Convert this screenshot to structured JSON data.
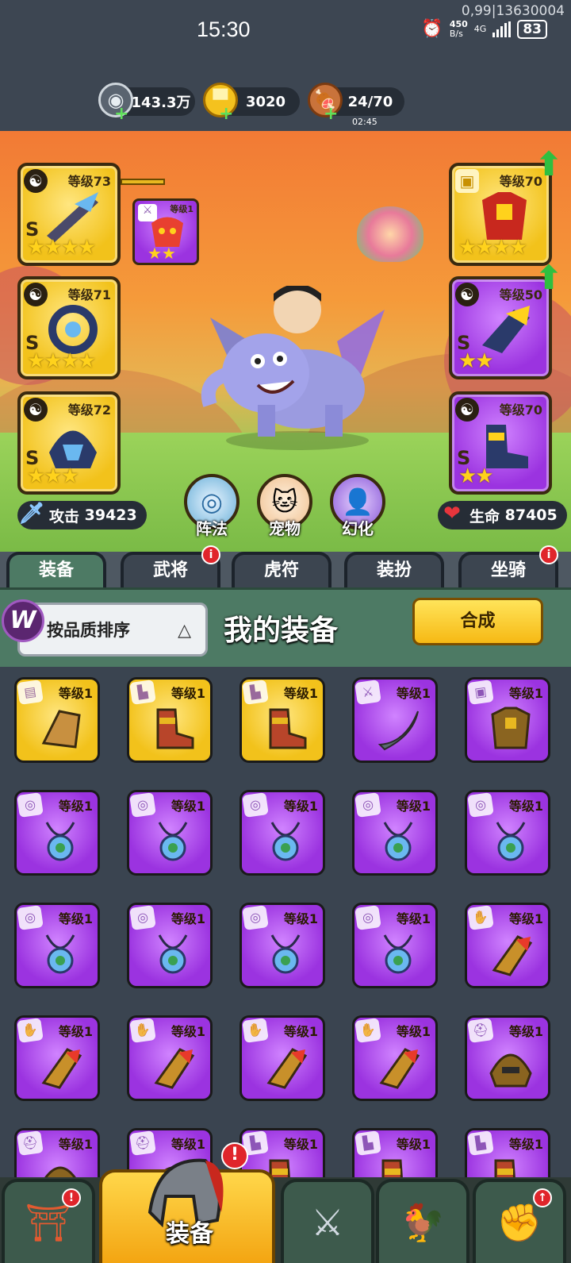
{
  "status_bar": {
    "time": "15:30",
    "overlay_text": "0,99|13630004",
    "net_speed_value": "450",
    "net_speed_unit": "B/s",
    "network": "4G",
    "battery": "83"
  },
  "resources": {
    "silver": "143.3万",
    "gold": "3020",
    "stamina": "24/70",
    "stamina_timer": "02:45"
  },
  "hero": {
    "left_slots": [
      {
        "level": "等级73",
        "grade": "S",
        "stars": "★★★★",
        "color": "gold"
      },
      {
        "level": "等级71",
        "grade": "S",
        "stars": "★★★★",
        "color": "gold"
      },
      {
        "level": "等级72",
        "grade": "S",
        "stars": "★★★",
        "color": "gold"
      }
    ],
    "right_slots": [
      {
        "level": "等级70",
        "grade": "S",
        "stars": "★★★★",
        "color": "gold"
      },
      {
        "level": "等级50",
        "grade": "S",
        "stars": "★★",
        "color": "purple"
      },
      {
        "level": "等级70",
        "grade": "S",
        "stars": "★★",
        "color": "purple"
      }
    ],
    "pet_slot": {
      "level": "等级1",
      "stars": "★★"
    },
    "attack_label": "攻击",
    "attack_value": "39423",
    "hp_label": "生命",
    "hp_value": "87405",
    "buttons": {
      "formation": "阵法",
      "pet": "宠物",
      "transform": "幻化"
    }
  },
  "tabs": [
    {
      "label": "装备",
      "active": true,
      "badge": false
    },
    {
      "label": "武将",
      "active": false,
      "badge": true
    },
    {
      "label": "虎符",
      "active": false,
      "badge": false
    },
    {
      "label": "装扮",
      "active": false,
      "badge": false
    },
    {
      "label": "坐骑",
      "active": false,
      "badge": true
    }
  ],
  "toolbar": {
    "sort_label": "按品质排序",
    "title": "我的装备",
    "compose_label": "合成"
  },
  "inventory": {
    "level_text": "等级1",
    "items": [
      {
        "color": "gold",
        "icon": "armor-piece-icon"
      },
      {
        "color": "gold",
        "icon": "boots-icon"
      },
      {
        "color": "gold",
        "icon": "boots-icon"
      },
      {
        "color": "purple",
        "icon": "scimitar-icon"
      },
      {
        "color": "purple",
        "icon": "chest-armor-icon"
      },
      {
        "color": "purple",
        "icon": "amulet-icon"
      },
      {
        "color": "purple",
        "icon": "amulet-icon"
      },
      {
        "color": "purple",
        "icon": "amulet-icon"
      },
      {
        "color": "purple",
        "icon": "amulet-icon"
      },
      {
        "color": "purple",
        "icon": "amulet-icon"
      },
      {
        "color": "purple",
        "icon": "amulet-icon"
      },
      {
        "color": "purple",
        "icon": "amulet-icon"
      },
      {
        "color": "purple",
        "icon": "amulet-icon"
      },
      {
        "color": "purple",
        "icon": "amulet-icon"
      },
      {
        "color": "purple",
        "icon": "gauntlet-icon"
      },
      {
        "color": "purple",
        "icon": "gauntlet-icon"
      },
      {
        "color": "purple",
        "icon": "gauntlet-icon"
      },
      {
        "color": "purple",
        "icon": "gauntlet-icon"
      },
      {
        "color": "purple",
        "icon": "gauntlet-icon"
      },
      {
        "color": "purple",
        "icon": "helmet-icon"
      },
      {
        "color": "purple",
        "icon": "helmet-icon"
      },
      {
        "color": "purple",
        "icon": "helmet-icon"
      },
      {
        "color": "purple",
        "icon": "boots-icon"
      },
      {
        "color": "purple",
        "icon": "boots-icon"
      },
      {
        "color": "purple",
        "icon": "boots-icon"
      }
    ]
  },
  "bottom_nav": {
    "active_label": "装备"
  },
  "colors": {
    "gold_slot": "#f2c21b",
    "purple_slot": "#9b33e0",
    "panel_green": "#4d7a64",
    "badge_red": "#e0252b"
  }
}
